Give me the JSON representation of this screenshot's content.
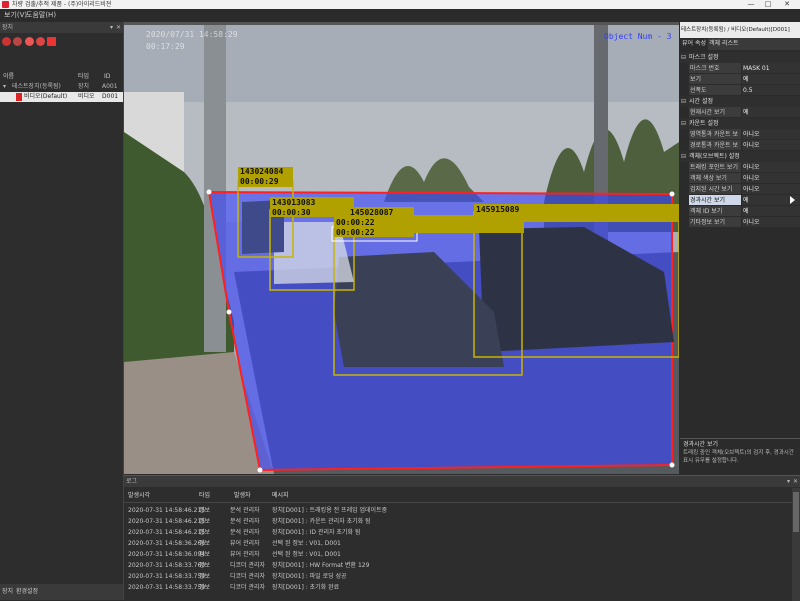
{
  "window": {
    "title": "차량 검출/추적 제품 - (주)아이리드비젼",
    "minimize": "—",
    "maximize": "□",
    "close": "✕"
  },
  "menu": [
    "보기(V)",
    "도움말(H)"
  ],
  "left_panel": {
    "title": "장치",
    "columns": [
      "이름",
      "타입",
      "ID"
    ],
    "rows": [
      {
        "name": "테스트장치(등록됨)",
        "type": "장치",
        "id": "A001"
      },
      {
        "name": "비디오(Default)",
        "type": "비디오",
        "id": "D001"
      }
    ],
    "bottom_tabs": [
      "장치",
      "환경설정"
    ]
  },
  "video": {
    "timestamp_line1": "2020/07/31 14:58:29",
    "timestamp_line2": "00:17:29",
    "overlay_label": "Object Num - 3",
    "boxes": [
      {
        "id": "143024084",
        "time": "00:00:29"
      },
      {
        "id": "143013083",
        "time": "00:00:30"
      },
      {
        "id": "145028087",
        "time": "00:00:22"
      },
      {
        "id": "145915089",
        "time": ""
      }
    ],
    "small_label": "00:00:22"
  },
  "right_panel": {
    "title": "테스트장치(등록됨) / 비디오(Default)[D001]",
    "tabs": [
      "뷰어 속성",
      "객체 리스트"
    ],
    "sections": [
      {
        "name": "마스크 설정",
        "props": [
          {
            "k": "마스크 번호",
            "v": "MASK 01"
          },
          {
            "k": "보기",
            "v": "예"
          },
          {
            "k": "선폭도",
            "v": "0.5"
          }
        ]
      },
      {
        "name": "시간 설정",
        "props": [
          {
            "k": "현재시간 보기",
            "v": "예"
          }
        ]
      },
      {
        "name": "카운트 설정",
        "props": [
          {
            "k": "영역통과 카운트 보기",
            "v": "아니오"
          },
          {
            "k": "경로통과 카운트 보기",
            "v": "아니오"
          }
        ]
      },
      {
        "name": "객체(오브젝트) 설정",
        "props": [
          {
            "k": "트래킹 포인트 보기",
            "v": "아니오"
          },
          {
            "k": "객체 색상 보기",
            "v": "아니오"
          },
          {
            "k": "검지된 시간 보기",
            "v": "아니오"
          },
          {
            "k": "경과시간 보기",
            "v": "예"
          },
          {
            "k": "객체 ID 보기",
            "v": "예"
          },
          {
            "k": "기타정보 보기",
            "v": "아니오"
          }
        ]
      }
    ],
    "selected_prop": "경과시간 보기",
    "desc_title": "경과시간 보기",
    "desc_text": "트래킹 중인 객체(오브젝트)의 검지 후, 경과시간 표시 유무를 설정합니다."
  },
  "log_panel": {
    "title": "로그",
    "columns": [
      "발생시각",
      "타입",
      "발생자",
      "메시지"
    ],
    "rows": [
      {
        "time": "2020-07-31 14:58:46.215",
        "type": "정보",
        "source": "분석 관리자",
        "msg": "장치[D001] : 트래킹용 전 프레임 업데이트중"
      },
      {
        "time": "2020-07-31 14:58:46.215",
        "type": "정보",
        "source": "분석 관리자",
        "msg": "장치[D001] : 카운트 관리자 초기화 됨"
      },
      {
        "time": "2020-07-31 14:58:46.215",
        "type": "정보",
        "source": "분석 관리자",
        "msg": "장치[D001] : ID 관리자 초기화 됨"
      },
      {
        "time": "2020-07-31 14:58:36.266",
        "type": "정보",
        "source": "뷰어 관리자",
        "msg": "선택 된 정보 : V01, D001"
      },
      {
        "time": "2020-07-31 14:58:36.094",
        "type": "정보",
        "source": "뷰어 관리자",
        "msg": "선택 된 정보 : V01, D001"
      },
      {
        "time": "2020-07-31 14:58:33.760",
        "type": "정보",
        "source": "디코더 관리자",
        "msg": "장치[D001] : HW Format 변환 129"
      },
      {
        "time": "2020-07-31 14:58:33.759",
        "type": "정보",
        "source": "디코더 관리자",
        "msg": "장치[D001] : 파일 로딩 성공"
      },
      {
        "time": "2020-07-31 14:58:33.759",
        "type": "정보",
        "source": "디코더 관리자",
        "msg": "장치[D001] : 초기화 완료"
      }
    ]
  },
  "colors": {
    "mask": "#3a46ff",
    "mask_border": "#ff2020",
    "box": "#c8b400",
    "label_bg": "#b0a000"
  }
}
